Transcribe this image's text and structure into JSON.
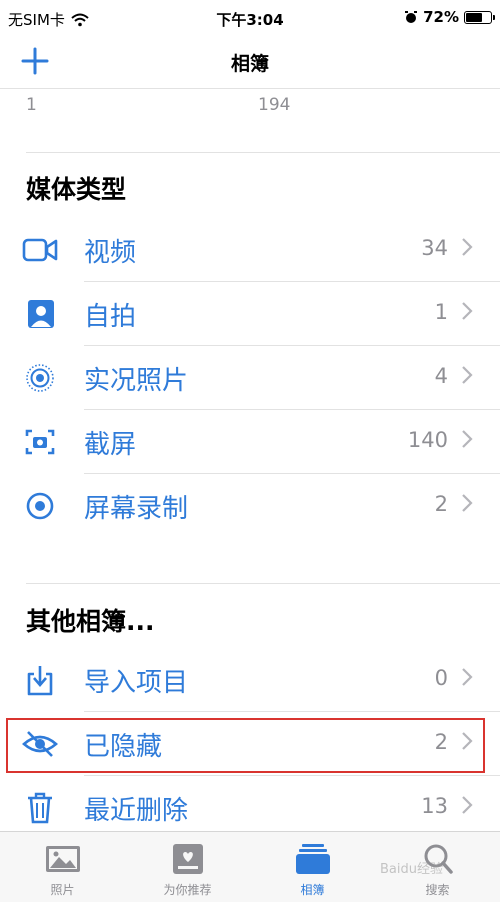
{
  "status_bar": {
    "carrier": "无SIM卡",
    "time": "下午3:04",
    "battery": "72%",
    "battery_level": 0.72
  },
  "nav": {
    "title": "相簿"
  },
  "top_row": {
    "left_value": "1",
    "right_value": "194"
  },
  "media_types": {
    "title": "媒体类型",
    "items": [
      {
        "label": "视频",
        "count": "34",
        "icon": "video-icon"
      },
      {
        "label": "自拍",
        "count": "1",
        "icon": "portrait-icon"
      },
      {
        "label": "实况照片",
        "count": "4",
        "icon": "live-photo-icon"
      },
      {
        "label": "截屏",
        "count": "140",
        "icon": "screenshot-icon"
      },
      {
        "label": "屏幕录制",
        "count": "2",
        "icon": "screen-record-icon"
      }
    ]
  },
  "other_albums": {
    "title": "其他相簿...",
    "items": [
      {
        "label": "导入项目",
        "count": "0",
        "icon": "import-icon"
      },
      {
        "label": "已隐藏",
        "count": "2",
        "icon": "hidden-eye-icon"
      },
      {
        "label": "最近删除",
        "count": "13",
        "icon": "trash-icon"
      }
    ]
  },
  "tabs": [
    {
      "label": "照片",
      "icon": "photos-tab-icon"
    },
    {
      "label": "为你推荐",
      "icon": "for-you-tab-icon"
    },
    {
      "label": "相簿",
      "icon": "albums-tab-icon",
      "active": true
    },
    {
      "label": "搜索",
      "icon": "search-tab-icon"
    }
  ],
  "watermark": "Baidu经验",
  "colors": {
    "accent": "#2f7bd9",
    "secondary_text": "#8e8e93",
    "highlight_border": "#d9342f"
  }
}
